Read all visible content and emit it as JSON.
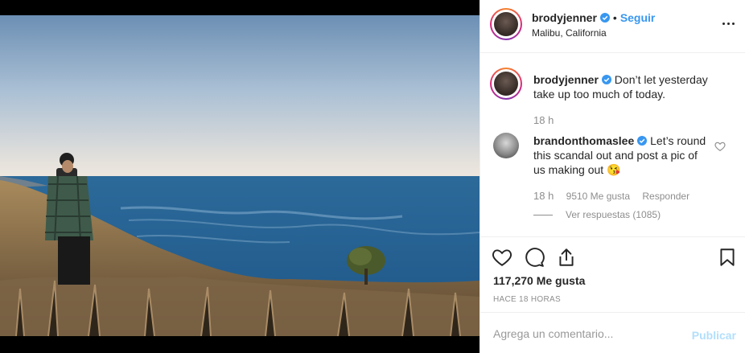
{
  "post": {
    "author": "brodyjenner",
    "follow_label": "Seguir",
    "dot": "•",
    "location": "Malibu, California",
    "caption": "Don’t let yesterday take up too much of today.",
    "caption_time": "18 h"
  },
  "comments": [
    {
      "author": "brandonthomaslee",
      "text": "Let’s round this scandal out and post a pic of us making out 😘",
      "time": "18 h",
      "likes": "9510 Me gusta",
      "reply_label": "Responder",
      "view_replies": "Ver respuestas (1085)"
    }
  ],
  "engagement": {
    "likes": "117,270 Me gusta",
    "time_ago": "HACE 18 HORAS"
  },
  "composer": {
    "placeholder": "Agrega un comentario...",
    "publish_label": "Publicar"
  },
  "icons": {
    "verified": "verified-badge-icon",
    "more": "more-options-icon",
    "like": "heart-icon",
    "comment": "comment-bubble-icon",
    "share": "share-icon",
    "save": "bookmark-icon"
  },
  "colors": {
    "link_blue": "#3897f0",
    "publish_disabled": "#b2dffc",
    "muted": "#8e8e8e",
    "text": "#262626"
  }
}
